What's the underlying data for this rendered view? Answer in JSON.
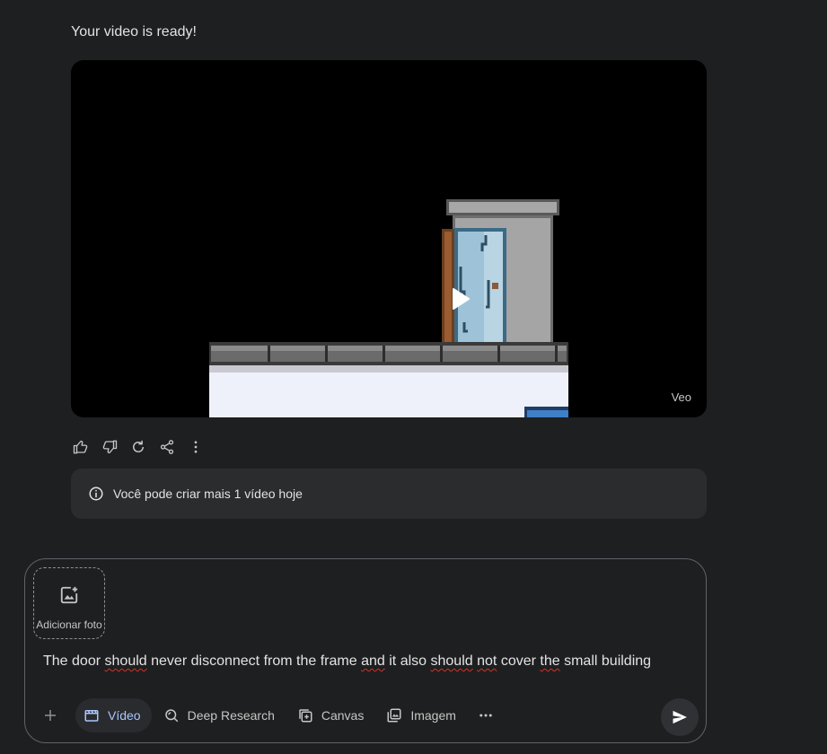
{
  "message": {
    "text": "Your video is ready!"
  },
  "video": {
    "watermark": "Veo"
  },
  "info": {
    "text": "Você pode criar mais 1 vídeo hoje"
  },
  "composer": {
    "attach_label": "Adicionar foto",
    "prompt_words": [
      "The",
      "door",
      "should",
      "never",
      "disconnect",
      "from",
      "the",
      "frame",
      "and",
      "it",
      "also",
      "should",
      "not",
      "cover",
      "the",
      "small",
      "building"
    ]
  },
  "toolbar": {
    "video_label": "Vídeo",
    "deep_research_label": "Deep Research",
    "canvas_label": "Canvas",
    "image_label": "Imagem"
  },
  "colors": {
    "accent": "#a8c7fa",
    "background": "#1e1f20",
    "panel": "#2b2c2e"
  }
}
